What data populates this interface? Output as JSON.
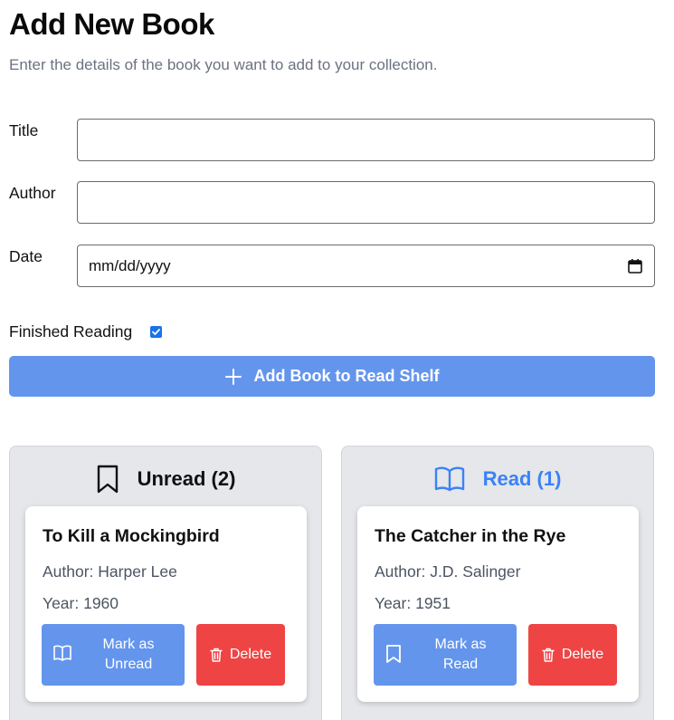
{
  "header": {
    "title": "Add New Book",
    "subtitle": "Enter the details of the book you want to add to your collection."
  },
  "form": {
    "title_label": "Title",
    "title_value": "",
    "author_label": "Author",
    "author_value": "",
    "date_label": "Date",
    "date_placeholder": "mm/dd/yyyy",
    "finished_label": "Finished Reading",
    "finished_checked": true,
    "submit_label": "Add Book to Read Shelf"
  },
  "shelves": {
    "unread": {
      "heading": "Unread (2)",
      "icon": "bookmark-icon",
      "book": {
        "title": "To Kill a Mockingbird",
        "author": "Author: Harper Lee",
        "year": "Year: 1960",
        "toggle_line1": "Mark as",
        "toggle_line2": "Unread",
        "delete_label": "Delete"
      }
    },
    "read": {
      "heading": "Read (1)",
      "icon": "open-book-icon",
      "book": {
        "title": "The Catcher in the Rye",
        "author": "Author: J.D. Salinger",
        "year": "Year: 1951",
        "toggle_line1": "Mark as",
        "toggle_line2": "Read",
        "delete_label": "Delete"
      }
    }
  },
  "colors": {
    "primary": "#6495ed",
    "danger": "#ef4444",
    "read_accent": "#3b82f6",
    "panel_bg": "#e5e7eb"
  }
}
